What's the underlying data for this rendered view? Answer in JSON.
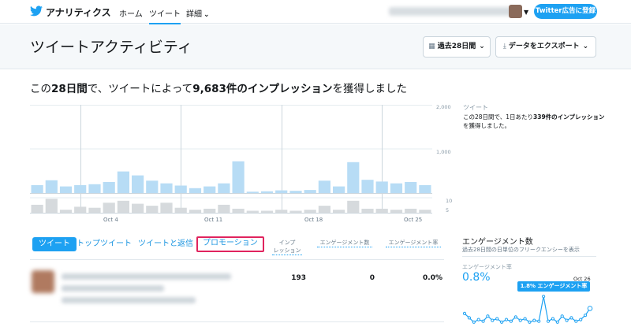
{
  "nav": {
    "brand": "アナリティクス",
    "home": "ホーム",
    "tweets": "ツイート",
    "more": "詳細",
    "more_caret": "⌄",
    "ad_button": "Twitter広告に登録"
  },
  "header": {
    "title": "ツイートアクティビティ",
    "period_button": "過去28日間",
    "export_button": "データをエクスポート"
  },
  "headline": {
    "prefix": "この",
    "period": "28日間",
    "mid": "で、ツイートによって",
    "count": "9,683件のインプレッション",
    "suffix": "を獲得しました"
  },
  "side": {
    "title": "ツイート",
    "desc_prefix": "この28日間で、1日あたり",
    "desc_bold": "339件のインプレッション",
    "desc_suffix": "を獲得しました。"
  },
  "chart_data": {
    "type": "bar",
    "title": "",
    "top_series": [
      180,
      290,
      150,
      180,
      200,
      250,
      490,
      400,
      280,
      220,
      170,
      110,
      150,
      220,
      720,
      30,
      40,
      60,
      50,
      70,
      280,
      150,
      700,
      300,
      260,
      220,
      250,
      180
    ],
    "bottom_series": [
      8,
      14,
      3,
      6,
      5,
      10,
      12,
      9,
      7,
      10,
      5,
      3,
      4,
      8,
      4,
      2,
      2,
      3,
      2,
      3,
      7,
      3,
      12,
      4,
      4,
      3,
      4,
      3
    ],
    "top_ylim": [
      0,
      2000
    ],
    "top_yticks": [
      "2,000",
      "1,000"
    ],
    "bottom_yticks": [
      "10",
      "5"
    ],
    "xticks": [
      "Oct 4",
      "Oct 11",
      "Oct 18",
      "Oct 25"
    ],
    "bar_color": "#b7dcf5",
    "bar_color_bottom": "#d6dadd"
  },
  "tabs": {
    "tweets": "ツイート",
    "top": "トップツイート",
    "replies": "ツイートと返信",
    "promotions": "プロモーション"
  },
  "columns": {
    "impressions_1": "インプ",
    "impressions_2": "レッション",
    "engagements": "エンゲージメント数",
    "rate": "エンゲージメント率"
  },
  "row": {
    "impressions": "193",
    "engagements": "0",
    "rate": "0.0%"
  },
  "engagement": {
    "title": "エンゲージメント数",
    "subtitle": "過去28日間の日単位のフリークエンシーを表示",
    "rate_label": "エンゲージメント率",
    "rate_value": "0.8%",
    "tooltip_date": "Oct 26",
    "tooltip_text": "1.8% エンゲージメント率",
    "line_values": [
      1.2,
      0.7,
      0.2,
      0.5,
      0.3,
      0.9,
      0.4,
      0.6,
      0.2,
      0.5,
      0.3,
      0.8,
      0.4,
      0.6,
      0.2,
      0.4,
      0.3,
      3.2,
      0.3,
      0.6,
      0.2,
      0.9,
      0.4,
      0.7,
      0.3,
      0.5,
      1.0,
      1.8
    ],
    "line_color": "#1da1f2"
  },
  "colors": {
    "accent": "#1da1f2",
    "promo_border": "#e0245e"
  },
  "icons": {
    "logo": "twitter-bird-icon",
    "calendar": "calendar-icon",
    "download": "download-icon"
  }
}
